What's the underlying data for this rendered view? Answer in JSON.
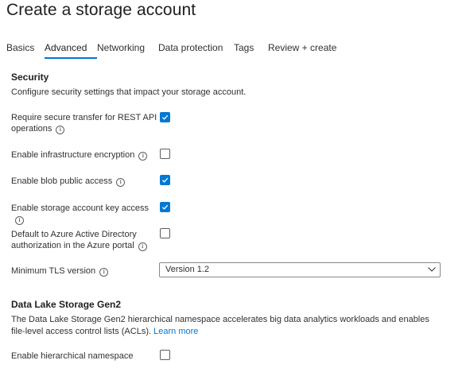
{
  "header": {
    "title": "Create a storage account",
    "more": "···"
  },
  "tabs": [
    {
      "label": "Basics"
    },
    {
      "label": "Advanced",
      "active": true
    },
    {
      "label": "Networking"
    },
    {
      "label": "Data protection"
    },
    {
      "label": "Tags"
    },
    {
      "label": "Review + create"
    }
  ],
  "security": {
    "heading": "Security",
    "description": "Configure security settings that impact your storage account.",
    "settings": [
      {
        "label": "Require secure transfer for REST API operations",
        "checked": true
      },
      {
        "label": "Enable infrastructure encryption",
        "checked": false
      },
      {
        "label": "Enable blob public access",
        "checked": true
      },
      {
        "label": "Enable storage account key access",
        "checked": true
      },
      {
        "label": "Default to Azure Active Directory authorization in the Azure portal",
        "checked": false
      }
    ],
    "tls": {
      "label": "Minimum TLS version",
      "value": "Version 1.2"
    }
  },
  "datalake": {
    "heading": "Data Lake Storage Gen2",
    "description": "The Data Lake Storage Gen2 hierarchical namespace accelerates big data analytics workloads and enables file-level access control lists (ACLs).",
    "link": "Learn more",
    "setting": {
      "label": "Enable hierarchical namespace",
      "checked": false
    }
  },
  "colors": {
    "accent": "#0078d4",
    "text": "#323130"
  }
}
